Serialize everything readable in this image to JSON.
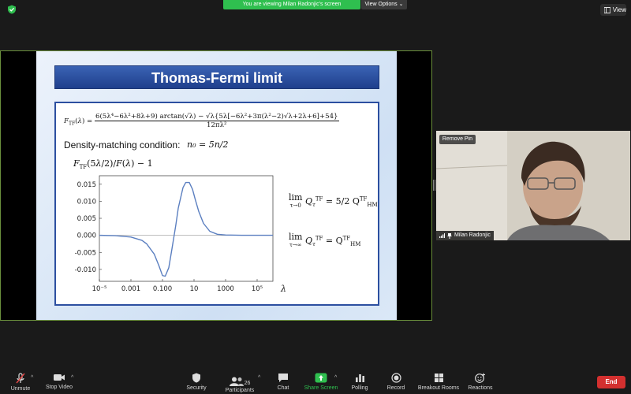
{
  "top_bar": {
    "banner_text": "You are viewing Milan Radonjic's screen",
    "view_options_label": "View Options",
    "view_label": "View"
  },
  "slide": {
    "title": "Thomas-Fermi limit",
    "formula_lhs": "F",
    "formula_numerator": "6(5λ⁴−6λ²+8λ+9) arctan(√λ) − √λ{5λ[−6λ²+3π(λ²−2)√λ+2λ+6]+54}",
    "formula_denominator": "12πλ²",
    "density_label": "Density-matching condition:",
    "density_math": "n₀ = 5n/2",
    "plot_label": "F",
    "limit1_rhs": "5/2 Q",
    "limit2_rhs": "= Q"
  },
  "chart_data": {
    "type": "line",
    "title": "",
    "xlabel": "λ",
    "ylabel": "F_TF(5λ/2)/F(λ) − 1",
    "x_scale": "log",
    "xlim": [
      1e-05,
      1000000
    ],
    "ylim": [
      -0.0135,
      0.0175
    ],
    "x_ticks": [
      "10⁻⁵",
      "0.001",
      "0.100",
      "10",
      "1000",
      "10⁵"
    ],
    "x_tick_values": [
      1e-05,
      0.001,
      0.1,
      10,
      1000,
      100000
    ],
    "y_ticks": [
      "0.015",
      "0.010",
      "0.005",
      "0.000",
      "-0.005",
      "-0.010"
    ],
    "y_tick_values": [
      0.015,
      0.01,
      0.005,
      0.0,
      -0.005,
      -0.01
    ],
    "series": [
      {
        "color": "#5b7fc0",
        "x": [
          1e-05,
          0.0001,
          0.001,
          0.005,
          0.01,
          0.03,
          0.06,
          0.1,
          0.15,
          0.25,
          0.4,
          0.7,
          1,
          2,
          3,
          5,
          8,
          12,
          20,
          40,
          100,
          300,
          1000,
          10000,
          100000,
          1000000
        ],
        "y": [
          0,
          -0.0001,
          -0.0005,
          -0.0015,
          -0.0025,
          -0.0055,
          -0.009,
          -0.0118,
          -0.012,
          -0.0095,
          -0.004,
          0.003,
          0.008,
          0.014,
          0.0155,
          0.0155,
          0.0135,
          0.0105,
          0.007,
          0.0035,
          0.0012,
          0.0003,
          0.0001,
          0,
          0,
          0
        ]
      }
    ]
  },
  "video": {
    "remove_pin_label": "Remove Pin",
    "participant_name": "Milan Radonjic"
  },
  "toolbar": {
    "unmute": "Unmute",
    "stop_video": "Stop Video",
    "security": "Security",
    "participants": "Participants",
    "participants_count": "26",
    "chat": "Chat",
    "share_screen": "Share Screen",
    "polling": "Polling",
    "record": "Record",
    "breakout_rooms": "Breakout Rooms",
    "reactions": "Reactions",
    "end": "End"
  },
  "colors": {
    "share_green": "#2fbf4f",
    "end_red": "#d3302f",
    "slide_title_blue": "#2c4fa0",
    "curve_blue": "#5b7fc0"
  }
}
